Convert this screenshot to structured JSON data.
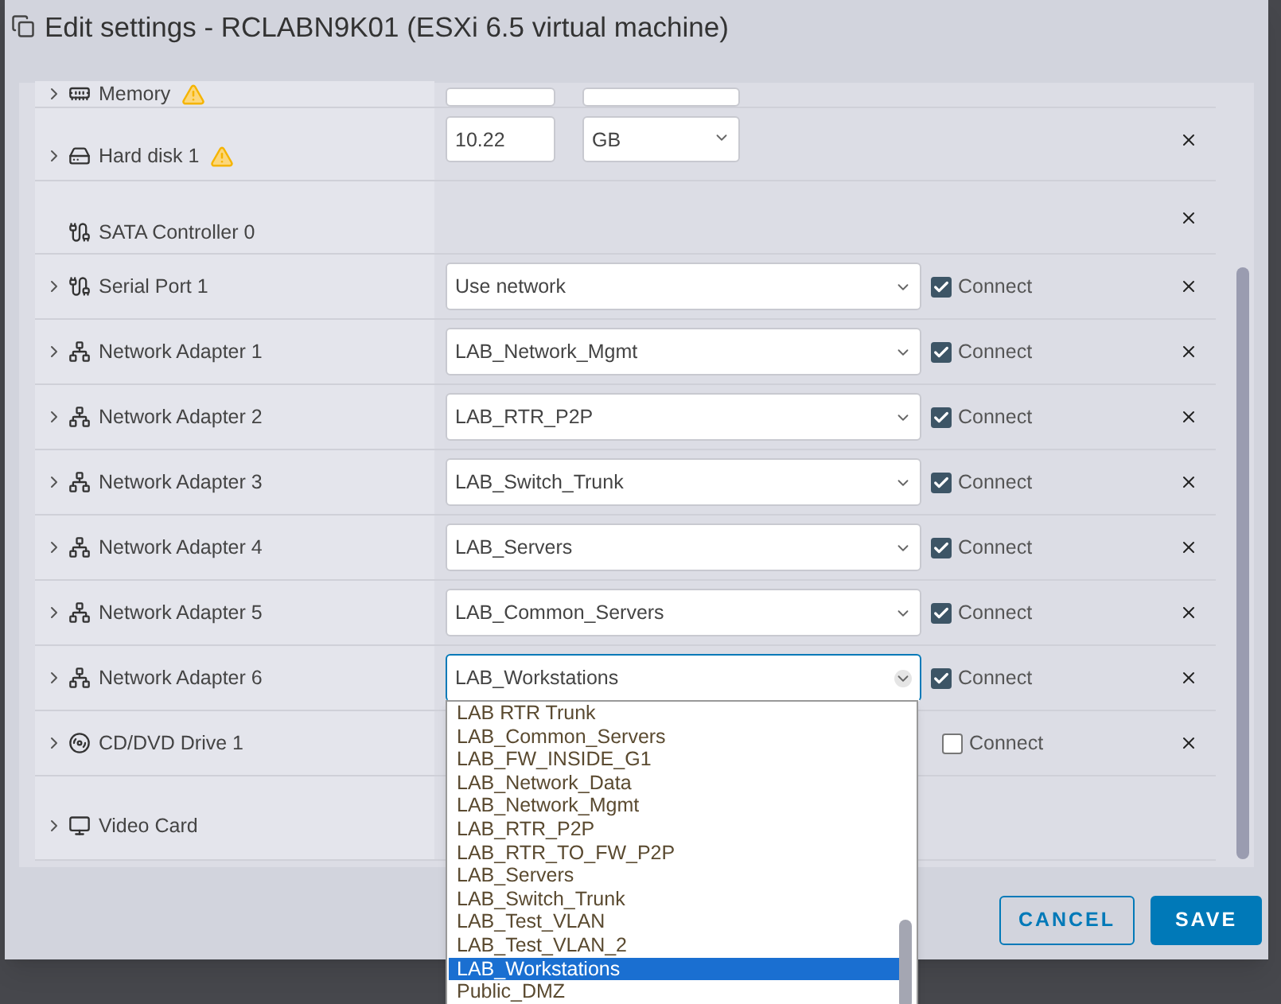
{
  "window": {
    "title": "Edit settings - RCLABN9K01 (ESXi 6.5 virtual machine)"
  },
  "devices": [
    {
      "kind": "memory",
      "label": "Memory",
      "expandable": true,
      "warning": true,
      "control": {
        "kind": "size"
      },
      "removable": false
    },
    {
      "kind": "hard_disk",
      "label": "Hard disk 1",
      "expandable": true,
      "warning": true,
      "control": {
        "kind": "size",
        "value": "10.22",
        "unit": "GB"
      },
      "removable": true
    },
    {
      "kind": "sata_controller",
      "label": "SATA Controller 0",
      "expandable": false,
      "warning": false,
      "control": {
        "kind": "none"
      },
      "removable": true
    },
    {
      "kind": "serial_port",
      "label": "Serial Port 1",
      "expandable": true,
      "warning": false,
      "control": {
        "kind": "select",
        "value": "Use network",
        "expanded": false
      },
      "connect": {
        "label": "Connect",
        "checked": true
      },
      "removable": true
    },
    {
      "kind": "network_adapter",
      "label": "Network Adapter 1",
      "expandable": true,
      "warning": false,
      "control": {
        "kind": "select",
        "value": "LAB_Network_Mgmt",
        "expanded": false
      },
      "connect": {
        "label": "Connect",
        "checked": true
      },
      "removable": true
    },
    {
      "kind": "network_adapter",
      "label": "Network Adapter 2",
      "expandable": true,
      "warning": false,
      "control": {
        "kind": "select",
        "value": "LAB_RTR_P2P",
        "expanded": false
      },
      "connect": {
        "label": "Connect",
        "checked": true
      },
      "removable": true
    },
    {
      "kind": "network_adapter",
      "label": "Network Adapter 3",
      "expandable": true,
      "warning": false,
      "control": {
        "kind": "select",
        "value": "LAB_Switch_Trunk",
        "expanded": false
      },
      "connect": {
        "label": "Connect",
        "checked": true
      },
      "removable": true
    },
    {
      "kind": "network_adapter",
      "label": "Network Adapter 4",
      "expandable": true,
      "warning": false,
      "control": {
        "kind": "select",
        "value": "LAB_Servers",
        "expanded": false
      },
      "connect": {
        "label": "Connect",
        "checked": true
      },
      "removable": true
    },
    {
      "kind": "network_adapter",
      "label": "Network Adapter 5",
      "expandable": true,
      "warning": false,
      "control": {
        "kind": "select",
        "value": "LAB_Common_Servers",
        "expanded": false
      },
      "connect": {
        "label": "Connect",
        "checked": true
      },
      "removable": true
    },
    {
      "kind": "network_adapter",
      "label": "Network Adapter 6",
      "expandable": true,
      "warning": false,
      "control": {
        "kind": "select",
        "value": "LAB_Workstations",
        "expanded": true,
        "options": [
          {
            "label": "LAB RTR Trunk",
            "selected": false
          },
          {
            "label": "LAB_Common_Servers",
            "selected": false
          },
          {
            "label": "LAB_FW_INSIDE_G1",
            "selected": false
          },
          {
            "label": "LAB_Network_Data",
            "selected": false
          },
          {
            "label": "LAB_Network_Mgmt",
            "selected": false
          },
          {
            "label": "LAB_RTR_P2P",
            "selected": false
          },
          {
            "label": "LAB_RTR_TO_FW_P2P",
            "selected": false
          },
          {
            "label": "LAB_Servers",
            "selected": false
          },
          {
            "label": "LAB_Switch_Trunk",
            "selected": false
          },
          {
            "label": "LAB_Test_VLAN",
            "selected": false
          },
          {
            "label": "LAB_Test_VLAN_2",
            "selected": false
          },
          {
            "label": "LAB_Workstations",
            "selected": true
          },
          {
            "label": "Public_DMZ",
            "selected": false
          }
        ]
      },
      "connect": {
        "label": "Connect",
        "checked": true
      },
      "removable": true
    },
    {
      "kind": "cd_dvd",
      "label": "CD/DVD Drive 1",
      "expandable": true,
      "warning": false,
      "control": {
        "kind": "none"
      },
      "connect": {
        "label": "Connect",
        "checked": false
      },
      "removable": true
    },
    {
      "kind": "video_card",
      "label": "Video Card",
      "expandable": true,
      "warning": false,
      "control": {
        "kind": "none"
      },
      "removable": false
    }
  ],
  "buttons": [
    {
      "kind": "secondary",
      "label": "CANCEL"
    },
    {
      "kind": "primary",
      "label": "SAVE"
    }
  ]
}
